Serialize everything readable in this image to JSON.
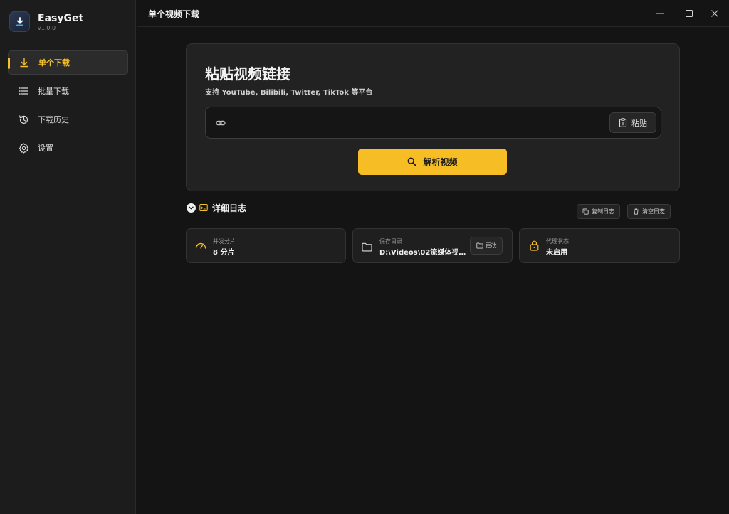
{
  "brand": {
    "name": "EasyGet",
    "version": "v1.0.0"
  },
  "sidebar": {
    "items": [
      {
        "label": "单个下载",
        "icon": "download-icon",
        "active": true
      },
      {
        "label": "批量下载",
        "icon": "list-icon",
        "active": false
      },
      {
        "label": "下载历史",
        "icon": "history-icon",
        "active": false
      },
      {
        "label": "设置",
        "icon": "gear-icon",
        "active": false
      }
    ]
  },
  "titlebar": {
    "title": "单个视频下载"
  },
  "main": {
    "title": "粘贴视频链接",
    "subtitle": "支持 YouTube, Bilibili, Twitter, TikTok 等平台",
    "url_input": {
      "value": "",
      "placeholder": ""
    },
    "paste_label": "粘贴",
    "parse_label": "解析视频"
  },
  "log": {
    "title": "详细日志",
    "copy_label": "复制日志",
    "clear_label": "清空日志"
  },
  "stats": {
    "concurrency": {
      "label": "并发分片",
      "value": "8 分片"
    },
    "save_dir": {
      "label": "保存目录",
      "value": "D:\\Videos\\02流媒体视...",
      "change_label": "更改"
    },
    "proxy": {
      "label": "代理状态",
      "value": "未启用"
    }
  },
  "colors": {
    "accent": "#f7bd25",
    "background": "#141414",
    "sidebar": "#1c1c1c",
    "card": "#222222"
  }
}
